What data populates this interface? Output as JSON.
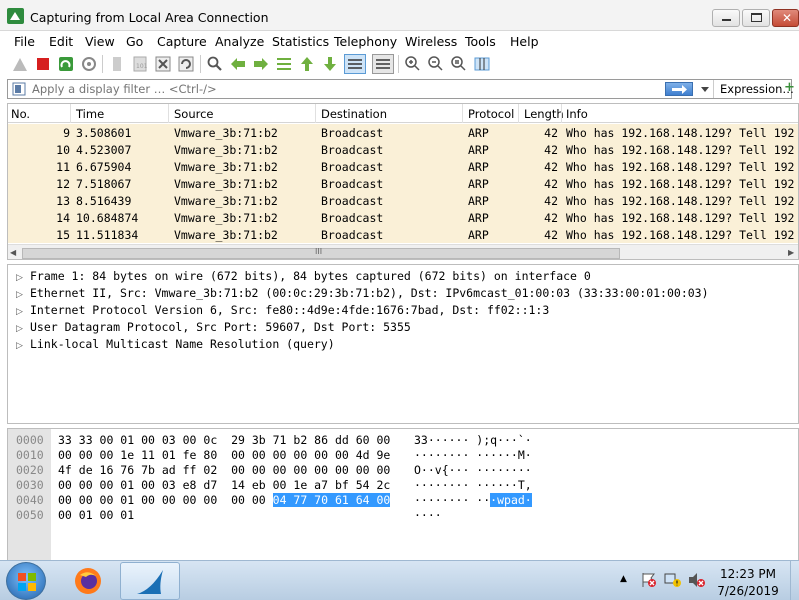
{
  "window": {
    "title": "Capturing from Local Area Connection",
    "minimize": "—",
    "maximize": "□",
    "close": "✕"
  },
  "menu": [
    "File",
    "Edit",
    "View",
    "Go",
    "Capture",
    "Analyze",
    "Statistics",
    "Telephony",
    "Wireless",
    "Tools",
    "Help"
  ],
  "filter": {
    "placeholder": "Apply a display filter … <Ctrl-/>",
    "expression_label": "Expression…",
    "plus": "+"
  },
  "packet_list": {
    "columns": [
      "No.",
      "Time",
      "Source",
      "Destination",
      "Protocol",
      "Length",
      "Info"
    ],
    "rows": [
      {
        "no": "9",
        "time": "3.508601",
        "src": "Vmware_3b:71:b2",
        "dst": "Broadcast",
        "proto": "ARP",
        "len": "42",
        "info": "Who has 192.168.148.129? Tell 192"
      },
      {
        "no": "10",
        "time": "4.523007",
        "src": "Vmware_3b:71:b2",
        "dst": "Broadcast",
        "proto": "ARP",
        "len": "42",
        "info": "Who has 192.168.148.129? Tell 192"
      },
      {
        "no": "11",
        "time": "6.675904",
        "src": "Vmware_3b:71:b2",
        "dst": "Broadcast",
        "proto": "ARP",
        "len": "42",
        "info": "Who has 192.168.148.129? Tell 192"
      },
      {
        "no": "12",
        "time": "7.518067",
        "src": "Vmware_3b:71:b2",
        "dst": "Broadcast",
        "proto": "ARP",
        "len": "42",
        "info": "Who has 192.168.148.129? Tell 192"
      },
      {
        "no": "13",
        "time": "8.516439",
        "src": "Vmware_3b:71:b2",
        "dst": "Broadcast",
        "proto": "ARP",
        "len": "42",
        "info": "Who has 192.168.148.129? Tell 192"
      },
      {
        "no": "14",
        "time": "10.684874",
        "src": "Vmware_3b:71:b2",
        "dst": "Broadcast",
        "proto": "ARP",
        "len": "42",
        "info": "Who has 192.168.148.129? Tell 192"
      },
      {
        "no": "15",
        "time": "11.511834",
        "src": "Vmware_3b:71:b2",
        "dst": "Broadcast",
        "proto": "ARP",
        "len": "42",
        "info": "Who has 192.168.148.129? Tell 192"
      }
    ],
    "row_color": "#faf0d7",
    "scroll_grip": "III"
  },
  "details": [
    "Frame 1: 84 bytes on wire (672 bits), 84 bytes captured (672 bits) on interface 0",
    "Ethernet II, Src: Vmware_3b:71:b2 (00:0c:29:3b:71:b2), Dst: IPv6mcast_01:00:03 (33:33:00:01:00:03)",
    "Internet Protocol Version 6, Src: fe80::4d9e:4fde:1676:7bad, Dst: ff02::1:3",
    "User Datagram Protocol, Src Port: 59607, Dst Port: 5355",
    "Link-local Multicast Name Resolution (query)"
  ],
  "bytes": [
    {
      "offset": "0000",
      "hex": "33 33 00 01 00 03 00 0c  29 3b 71 b2 86 dd 60 00",
      "hl_hex": "",
      "ascii": "33······ );q···`·",
      "hl_ascii": ""
    },
    {
      "offset": "0010",
      "hex": "00 00 00 1e 11 01 fe 80  00 00 00 00 00 00 4d 9e",
      "hl_hex": "",
      "ascii": "········ ······M·",
      "hl_ascii": ""
    },
    {
      "offset": "0020",
      "hex": "4f de 16 76 7b ad ff 02  00 00 00 00 00 00 00 00",
      "hl_hex": "",
      "ascii": "O··v{··· ········",
      "hl_ascii": ""
    },
    {
      "offset": "0030",
      "hex": "00 00 00 01 00 03 e8 d7  14 eb 00 1e a7 bf 54 2c",
      "hl_hex": "",
      "ascii": "········ ······T,",
      "hl_ascii": ""
    },
    {
      "offset": "0040",
      "hex": "00 00 00 01 00 00 00 00  00 00 ",
      "hl_hex": "04 77 70 61 64 00",
      "ascii": "········ ··",
      "hl_ascii": "·wpad·"
    },
    {
      "offset": "0050",
      "hex": "00 01 00 01",
      "hl_hex": "",
      "ascii": "····",
      "hl_ascii": ""
    }
  ],
  "taskbar": {
    "time": "12:23 PM",
    "date": "7/26/2019"
  },
  "colors": {
    "accent": "#3399ff",
    "row_bg": "#faf0d7"
  }
}
